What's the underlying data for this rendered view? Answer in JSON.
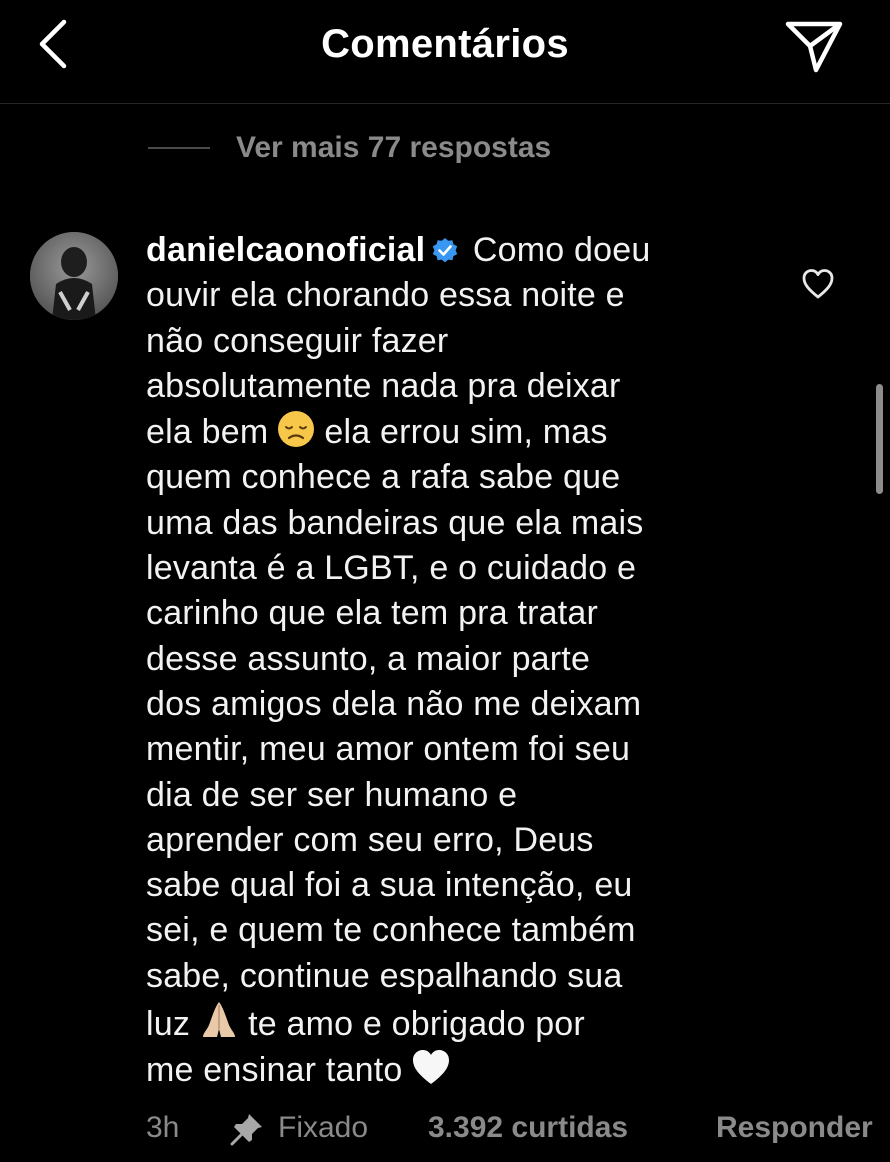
{
  "header": {
    "title": "Comentários",
    "back_icon": "chevron-left-icon",
    "send_icon": "paper-plane-icon"
  },
  "replies": {
    "more_label": "Ver mais 77 respostas"
  },
  "comment": {
    "username": "danielcaonoficial",
    "verified_icon": "verified-badge-icon",
    "lines": [
      "Como doeu",
      "ouvir ela chorando essa noite e",
      "não conseguir fazer",
      "absolutamente nada pra deixar",
      "ela bem",
      "ela errou sim, mas",
      "quem conhece a rafa sabe que",
      "uma das bandeiras que ela mais",
      "levanta é a LGBT, e o cuidado e",
      "carinho que ela tem pra tratar",
      "desse assunto, a maior parte",
      "dos amigos dela não me deixam",
      "mentir, meu amor ontem foi seu",
      "dia de ser ser humano e",
      "aprender com seu erro, Deus",
      "sabe qual foi a sua intenção, eu",
      "sei, e quem te conhece também",
      "sabe, continue espalhando sua",
      "luz",
      "te amo e obrigado por",
      "me ensinar tanto"
    ],
    "emojis": [
      "disappointed-face-emoji",
      "folded-hands-emoji",
      "white-heart-emoji"
    ],
    "like_icon": "heart-outline-icon"
  },
  "footer": {
    "time": "3h",
    "pin_icon": "pushpin-icon",
    "pinned_label": "Fixado",
    "likes": "3.392 curtidas",
    "reply_label": "Responder"
  },
  "colors": {
    "background": "#000000",
    "text": "#f2f2f2",
    "muted": "#8a8a8a",
    "verified": "#3897f0"
  }
}
